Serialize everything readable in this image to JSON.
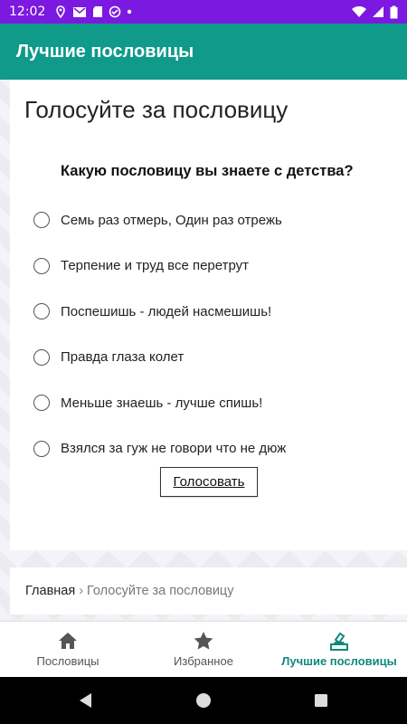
{
  "status_bar": {
    "time": "12:02"
  },
  "app_bar": {
    "title": "Лучшие пословицы"
  },
  "poll": {
    "heading": "Голосуйте за пословицу",
    "question": "Какую пословицу вы знаете с детства?",
    "options": [
      "Семь раз отмерь, Один раз отрежь",
      "Терпение и труд все перетрут",
      "Поспешишь - людей насмешишь!",
      "Правда глаза колет",
      "Меньше знаешь - лучше спишь!",
      "Взялся за гуж не говори что не дюж"
    ],
    "vote_label": "Голосовать"
  },
  "breadcrumb": {
    "home": "Главная",
    "separator": "›",
    "current": "Голосуйте за пословицу"
  },
  "bottom_nav": {
    "items": [
      {
        "label": "Пословицы",
        "icon": "home-icon"
      },
      {
        "label": "Избранное",
        "icon": "star-icon"
      },
      {
        "label": "Лучшие пословицы",
        "icon": "vote-icon"
      }
    ],
    "active_index": 2
  },
  "colors": {
    "status_bar": "#7c19e0",
    "app_bar": "#0f9a8a",
    "accent": "#0f8a7c"
  }
}
